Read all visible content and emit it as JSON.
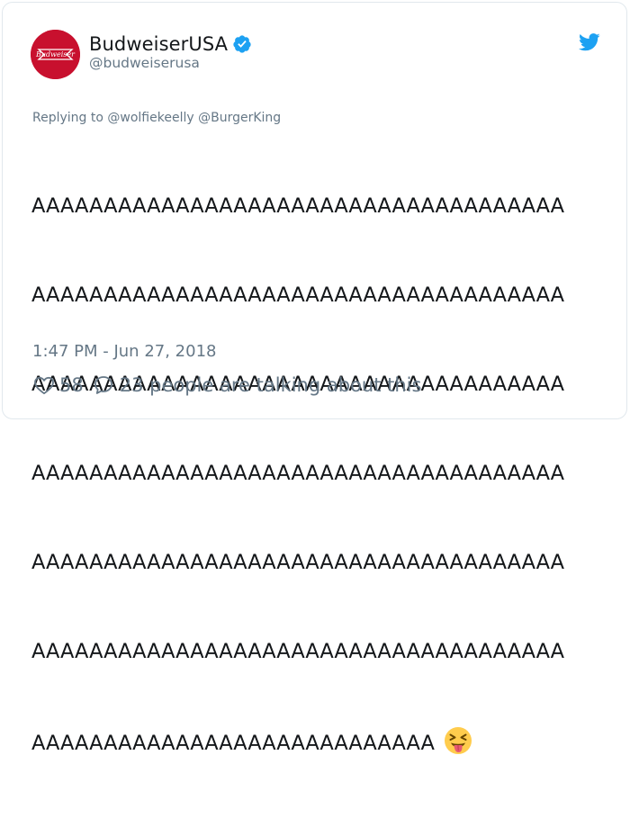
{
  "account": {
    "display_name": "BudweiserUSA",
    "handle": "@budweiserusa",
    "verified": true,
    "avatar_logo_text": "Budweiser"
  },
  "reply": {
    "prefix": "Replying to",
    "mentions": [
      "@wolfiekeelly",
      "@BurgerKing"
    ]
  },
  "tweet": {
    "lines": [
      "AAAAAAAAAAAAAAAAAAAAAAAAAAAAAAAAAAAAA",
      "AAAAAAAAAAAAAAAAAAAAAAAAAAAAAAAAAAAAA",
      "AAAAAAAAAAAAAAAAAAAAAAAAAAAAAAAAAAAAA",
      "AAAAAAAAAAAAAAAAAAAAAAAAAAAAAAAAAAAAA",
      "AAAAAAAAAAAAAAAAAAAAAAAAAAAAAAAAAAAAA",
      "AAAAAAAAAAAAAAAAAAAAAAAAAAAAAAAAAAAAA",
      "AAAAAAAAAAAAAAAAAAAAAAAAAAAA"
    ],
    "emoji": "squinting-face-with-tongue"
  },
  "meta": {
    "timestamp": "1:47 PM - Jun 27, 2018"
  },
  "actions": {
    "like_count": "58",
    "talking_text": "23 people are talking about this"
  },
  "colors": {
    "text": "#14171a",
    "muted": "#657786",
    "twitter_blue": "#1da1f2",
    "brand_red": "#c8102e"
  }
}
